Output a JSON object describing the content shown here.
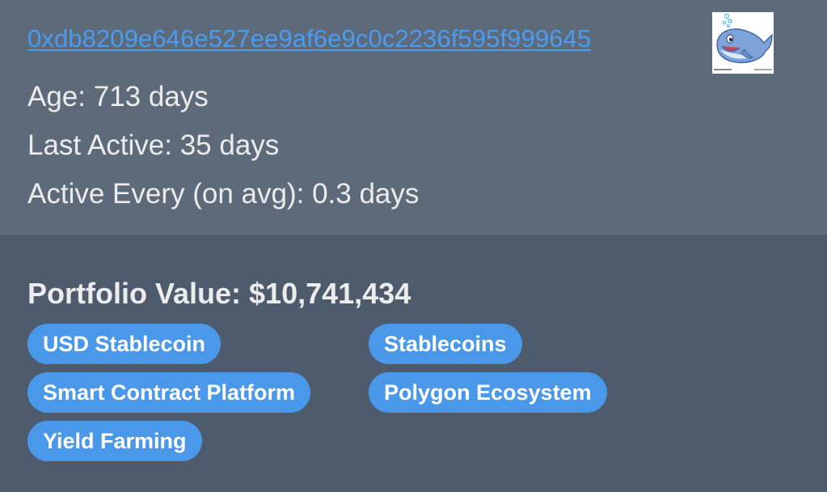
{
  "wallet": {
    "address": "0xdb8209e646e527ee9af6e9c0c2236f595f999645",
    "avatar_icon": "whale-icon",
    "age_text": "Age: 713 days",
    "last_active_text": "Last Active: 35 days",
    "active_every_text": "Active Every (on avg): 0.3 days"
  },
  "portfolio": {
    "value_text": "Portfolio Value: $10,741,434",
    "tags": [
      "USD Stablecoin",
      "Stablecoins",
      "Smart Contract Platform",
      "Polygon Ecosystem",
      "Yield Farming"
    ]
  },
  "colors": {
    "top_bg": "#5d6a79",
    "bottom_bg": "#4d5b6c",
    "link": "#4b9bf0",
    "tag_bg": "#4a98ea"
  }
}
